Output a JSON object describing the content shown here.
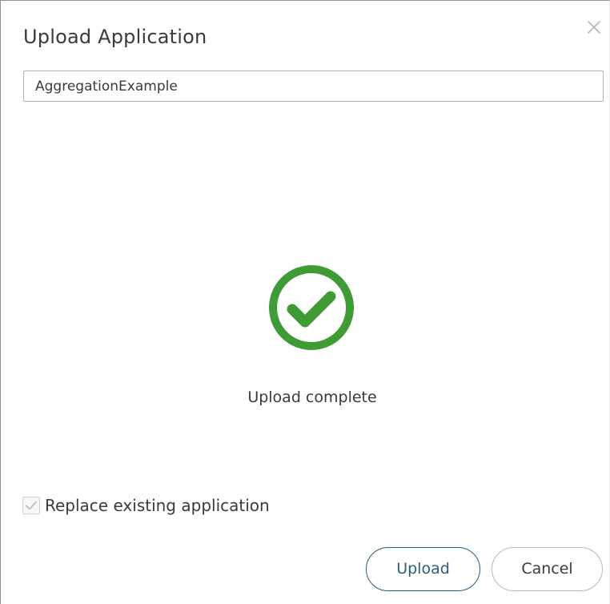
{
  "dialog": {
    "title": "Upload Application",
    "close_icon": "close-icon"
  },
  "name_input": {
    "value": "AggregationExample"
  },
  "status": {
    "icon": "check-circle-icon",
    "icon_color": "#3f9c35",
    "text": "Upload complete"
  },
  "replace_option": {
    "label": "Replace existing application",
    "checked": true,
    "disabled": true
  },
  "buttons": {
    "upload_label": "Upload",
    "cancel_label": "Cancel"
  },
  "colors": {
    "primary_button": "#2b5d7b",
    "success": "#3f9c35"
  }
}
